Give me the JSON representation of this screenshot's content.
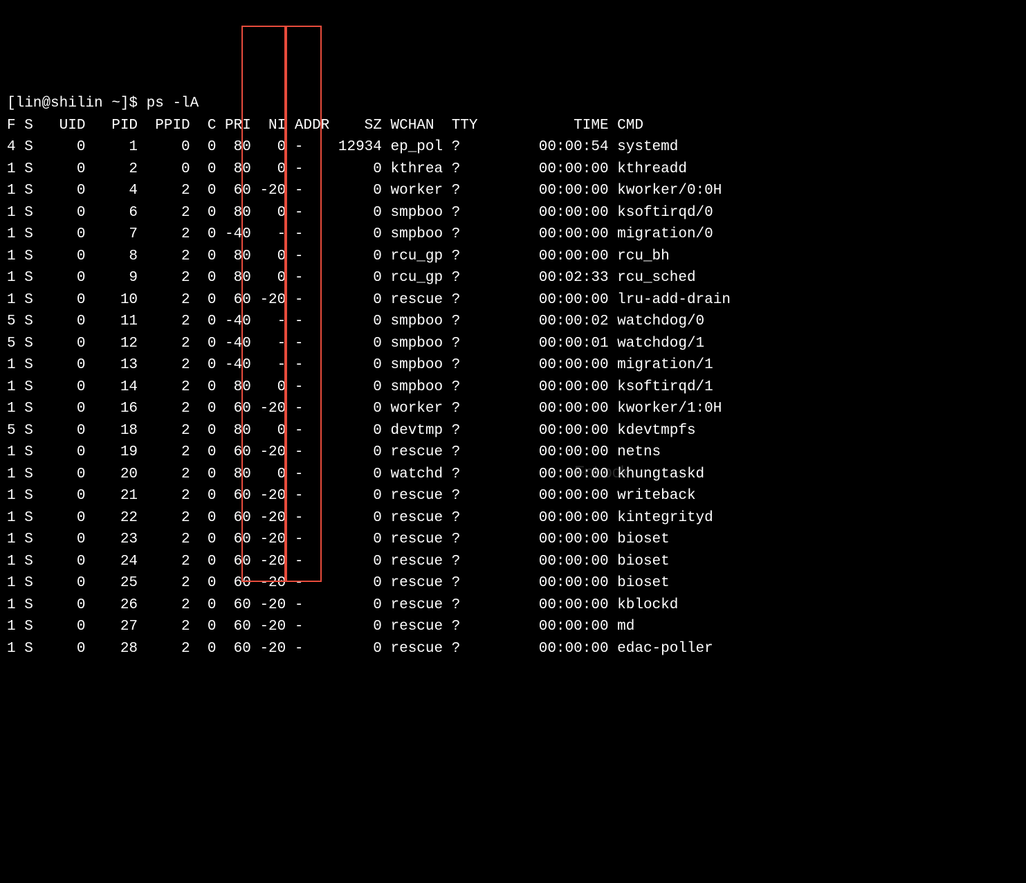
{
  "prompt": "[lin@shilin ~]$ ps -lA",
  "header": {
    "F": "F",
    "S": "S",
    "UID": "UID",
    "PID": "PID",
    "PPID": "PPID",
    "C": "C",
    "PRI": "PRI",
    "NI": "NI",
    "ADDR": "ADDR",
    "SZ": "SZ",
    "WCHAN": "WCHAN",
    "TTY": "TTY",
    "TIME": "TIME",
    "CMD": "CMD"
  },
  "rows": [
    {
      "F": "4",
      "S": "S",
      "UID": "0",
      "PID": "1",
      "PPID": "0",
      "C": "0",
      "PRI": "80",
      "NI": "0",
      "ADDR": "-",
      "SZ": "12934",
      "WCHAN": "ep_pol",
      "TTY": "?",
      "TIME": "00:00:54",
      "CMD": "systemd"
    },
    {
      "F": "1",
      "S": "S",
      "UID": "0",
      "PID": "2",
      "PPID": "0",
      "C": "0",
      "PRI": "80",
      "NI": "0",
      "ADDR": "-",
      "SZ": "0",
      "WCHAN": "kthrea",
      "TTY": "?",
      "TIME": "00:00:00",
      "CMD": "kthreadd"
    },
    {
      "F": "1",
      "S": "S",
      "UID": "0",
      "PID": "4",
      "PPID": "2",
      "C": "0",
      "PRI": "60",
      "NI": "-20",
      "ADDR": "-",
      "SZ": "0",
      "WCHAN": "worker",
      "TTY": "?",
      "TIME": "00:00:00",
      "CMD": "kworker/0:0H"
    },
    {
      "F": "1",
      "S": "S",
      "UID": "0",
      "PID": "6",
      "PPID": "2",
      "C": "0",
      "PRI": "80",
      "NI": "0",
      "ADDR": "-",
      "SZ": "0",
      "WCHAN": "smpboo",
      "TTY": "?",
      "TIME": "00:00:00",
      "CMD": "ksoftirqd/0"
    },
    {
      "F": "1",
      "S": "S",
      "UID": "0",
      "PID": "7",
      "PPID": "2",
      "C": "0",
      "PRI": "-40",
      "NI": "-",
      "ADDR": "-",
      "SZ": "0",
      "WCHAN": "smpboo",
      "TTY": "?",
      "TIME": "00:00:00",
      "CMD": "migration/0"
    },
    {
      "F": "1",
      "S": "S",
      "UID": "0",
      "PID": "8",
      "PPID": "2",
      "C": "0",
      "PRI": "80",
      "NI": "0",
      "ADDR": "-",
      "SZ": "0",
      "WCHAN": "rcu_gp",
      "TTY": "?",
      "TIME": "00:00:00",
      "CMD": "rcu_bh"
    },
    {
      "F": "1",
      "S": "S",
      "UID": "0",
      "PID": "9",
      "PPID": "2",
      "C": "0",
      "PRI": "80",
      "NI": "0",
      "ADDR": "-",
      "SZ": "0",
      "WCHAN": "rcu_gp",
      "TTY": "?",
      "TIME": "00:02:33",
      "CMD": "rcu_sched"
    },
    {
      "F": "1",
      "S": "S",
      "UID": "0",
      "PID": "10",
      "PPID": "2",
      "C": "0",
      "PRI": "60",
      "NI": "-20",
      "ADDR": "-",
      "SZ": "0",
      "WCHAN": "rescue",
      "TTY": "?",
      "TIME": "00:00:00",
      "CMD": "lru-add-drain"
    },
    {
      "F": "5",
      "S": "S",
      "UID": "0",
      "PID": "11",
      "PPID": "2",
      "C": "0",
      "PRI": "-40",
      "NI": "-",
      "ADDR": "-",
      "SZ": "0",
      "WCHAN": "smpboo",
      "TTY": "?",
      "TIME": "00:00:02",
      "CMD": "watchdog/0"
    },
    {
      "F": "5",
      "S": "S",
      "UID": "0",
      "PID": "12",
      "PPID": "2",
      "C": "0",
      "PRI": "-40",
      "NI": "-",
      "ADDR": "-",
      "SZ": "0",
      "WCHAN": "smpboo",
      "TTY": "?",
      "TIME": "00:00:01",
      "CMD": "watchdog/1"
    },
    {
      "F": "1",
      "S": "S",
      "UID": "0",
      "PID": "13",
      "PPID": "2",
      "C": "0",
      "PRI": "-40",
      "NI": "-",
      "ADDR": "-",
      "SZ": "0",
      "WCHAN": "smpboo",
      "TTY": "?",
      "TIME": "00:00:00",
      "CMD": "migration/1"
    },
    {
      "F": "1",
      "S": "S",
      "UID": "0",
      "PID": "14",
      "PPID": "2",
      "C": "0",
      "PRI": "80",
      "NI": "0",
      "ADDR": "-",
      "SZ": "0",
      "WCHAN": "smpboo",
      "TTY": "?",
      "TIME": "00:00:00",
      "CMD": "ksoftirqd/1"
    },
    {
      "F": "1",
      "S": "S",
      "UID": "0",
      "PID": "16",
      "PPID": "2",
      "C": "0",
      "PRI": "60",
      "NI": "-20",
      "ADDR": "-",
      "SZ": "0",
      "WCHAN": "worker",
      "TTY": "?",
      "TIME": "00:00:00",
      "CMD": "kworker/1:0H"
    },
    {
      "F": "5",
      "S": "S",
      "UID": "0",
      "PID": "18",
      "PPID": "2",
      "C": "0",
      "PRI": "80",
      "NI": "0",
      "ADDR": "-",
      "SZ": "0",
      "WCHAN": "devtmp",
      "TTY": "?",
      "TIME": "00:00:00",
      "CMD": "kdevtmpfs"
    },
    {
      "F": "1",
      "S": "S",
      "UID": "0",
      "PID": "19",
      "PPID": "2",
      "C": "0",
      "PRI": "60",
      "NI": "-20",
      "ADDR": "-",
      "SZ": "0",
      "WCHAN": "rescue",
      "TTY": "?",
      "TIME": "00:00:00",
      "CMD": "netns"
    },
    {
      "F": "1",
      "S": "S",
      "UID": "0",
      "PID": "20",
      "PPID": "2",
      "C": "0",
      "PRI": "80",
      "NI": "0",
      "ADDR": "-",
      "SZ": "0",
      "WCHAN": "watchd",
      "TTY": "?",
      "TIME": "00:00:00",
      "CMD": "khungtaskd"
    },
    {
      "F": "1",
      "S": "S",
      "UID": "0",
      "PID": "21",
      "PPID": "2",
      "C": "0",
      "PRI": "60",
      "NI": "-20",
      "ADDR": "-",
      "SZ": "0",
      "WCHAN": "rescue",
      "TTY": "?",
      "TIME": "00:00:00",
      "CMD": "writeback"
    },
    {
      "F": "1",
      "S": "S",
      "UID": "0",
      "PID": "22",
      "PPID": "2",
      "C": "0",
      "PRI": "60",
      "NI": "-20",
      "ADDR": "-",
      "SZ": "0",
      "WCHAN": "rescue",
      "TTY": "?",
      "TIME": "00:00:00",
      "CMD": "kintegrityd"
    },
    {
      "F": "1",
      "S": "S",
      "UID": "0",
      "PID": "23",
      "PPID": "2",
      "C": "0",
      "PRI": "60",
      "NI": "-20",
      "ADDR": "-",
      "SZ": "0",
      "WCHAN": "rescue",
      "TTY": "?",
      "TIME": "00:00:00",
      "CMD": "bioset"
    },
    {
      "F": "1",
      "S": "S",
      "UID": "0",
      "PID": "24",
      "PPID": "2",
      "C": "0",
      "PRI": "60",
      "NI": "-20",
      "ADDR": "-",
      "SZ": "0",
      "WCHAN": "rescue",
      "TTY": "?",
      "TIME": "00:00:00",
      "CMD": "bioset"
    },
    {
      "F": "1",
      "S": "S",
      "UID": "0",
      "PID": "25",
      "PPID": "2",
      "C": "0",
      "PRI": "60",
      "NI": "-20",
      "ADDR": "-",
      "SZ": "0",
      "WCHAN": "rescue",
      "TTY": "?",
      "TIME": "00:00:00",
      "CMD": "bioset"
    },
    {
      "F": "1",
      "S": "S",
      "UID": "0",
      "PID": "26",
      "PPID": "2",
      "C": "0",
      "PRI": "60",
      "NI": "-20",
      "ADDR": "-",
      "SZ": "0",
      "WCHAN": "rescue",
      "TTY": "?",
      "TIME": "00:00:00",
      "CMD": "kblockd"
    },
    {
      "F": "1",
      "S": "S",
      "UID": "0",
      "PID": "27",
      "PPID": "2",
      "C": "0",
      "PRI": "60",
      "NI": "-20",
      "ADDR": "-",
      "SZ": "0",
      "WCHAN": "rescue",
      "TTY": "?",
      "TIME": "00:00:00",
      "CMD": "md"
    },
    {
      "F": "1",
      "S": "S",
      "UID": "0",
      "PID": "28",
      "PPID": "2",
      "C": "0",
      "PRI": "60",
      "NI": "-20",
      "ADDR": "-",
      "SZ": "0",
      "WCHAN": "rescue",
      "TTY": "?",
      "TIME": "00:00:00",
      "CMD": "edac-poller"
    }
  ],
  "overlay": {
    "fnlock": "FnLock"
  }
}
